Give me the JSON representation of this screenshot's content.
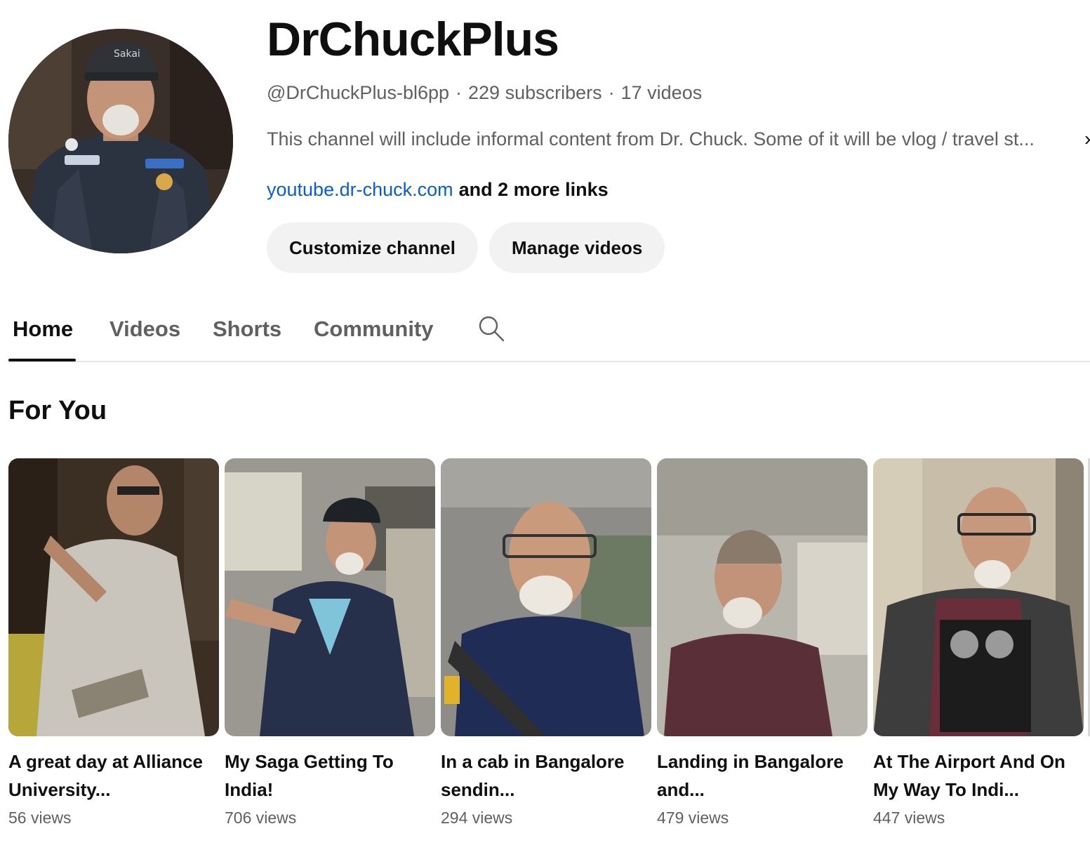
{
  "channel": {
    "name": "DrChuckPlus",
    "handle": "@DrChuckPlus-bl6pp",
    "subscribers": "229 subscribers",
    "videos_count": "17 videos",
    "separator": "·",
    "description": "This channel will include informal content from Dr. Chuck. Some of it will be vlog / travel st...",
    "description_chevron": "›",
    "link": "youtube.dr-chuck.com",
    "more_links": "and 2 more links"
  },
  "buttons": {
    "customize": "Customize channel",
    "manage": "Manage videos"
  },
  "tabs": [
    {
      "label": "Home",
      "active": true
    },
    {
      "label": "Videos",
      "active": false
    },
    {
      "label": "Shorts",
      "active": false
    },
    {
      "label": "Community",
      "active": false
    }
  ],
  "section": {
    "title": "For You"
  },
  "shorts": [
    {
      "title": "A great day at Alliance University...",
      "views": "56 views"
    },
    {
      "title": "My Saga Getting To India!",
      "views": "706 views"
    },
    {
      "title": "In a cab in Bangalore sendin...",
      "views": "294 views"
    },
    {
      "title": "Landing in Bangalore and...",
      "views": "479 views"
    },
    {
      "title": "At The Airport And On My Way To Indi...",
      "views": "447 views"
    }
  ],
  "colors": {
    "text_primary": "#0f0f0f",
    "text_secondary": "#606060",
    "link": "#065fd4",
    "pill_bg": "#f2f2f2"
  }
}
